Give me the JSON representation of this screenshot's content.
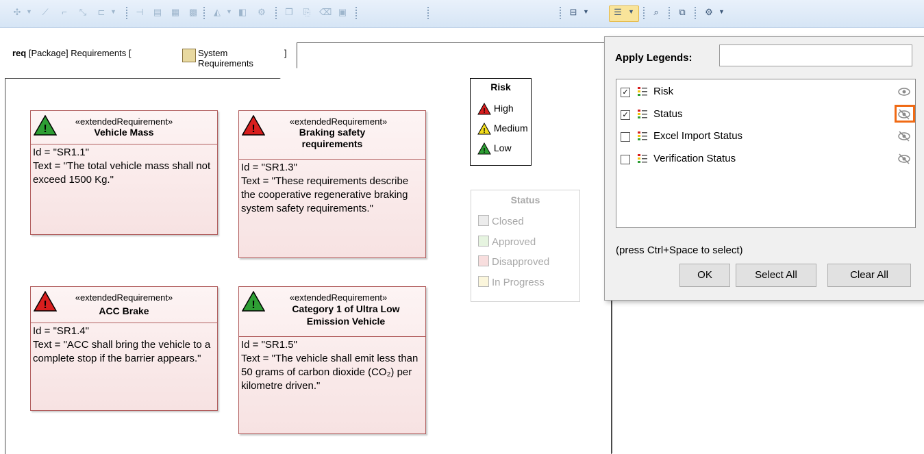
{
  "diagram": {
    "kind": "req",
    "frame_prefix": "[Package] Requirements [",
    "system_name_line1": "System",
    "system_name_line2": "Requirements",
    "frame_suffix": "]"
  },
  "requirements": [
    {
      "stereotype": "«extendedRequirement»",
      "name": "Vehicle Mass",
      "risk": "low",
      "body": "Id = \"SR1.1\"\nText = \"The total vehicle mass shall not exceed 1500 Kg.\""
    },
    {
      "stereotype": "«extendedRequirement»",
      "name": "Braking safety requirements",
      "risk": "high",
      "body": "Id = \"SR1.3\"\nText = \"These requirements describe the cooperative regenerative braking system safety requirements.\""
    },
    {
      "stereotype": "«extendedRequirement»",
      "name": "ACC Brake",
      "risk": "high",
      "body": "Id = \"SR1.4\"\nText = \"ACC shall bring the vehicle to a complete stop if the barrier appears.\""
    },
    {
      "stereotype": "«extendedRequirement»",
      "name": "Category 1 of Ultra Low Emission Vehicle",
      "risk": "low",
      "body": "Id = \"SR1.5\"\nText = \"The vehicle shall emit less than 50 grams of carbon dioxide (CO₂) per kilometre driven.\""
    }
  ],
  "risk_legend": {
    "title": "Risk",
    "items": [
      {
        "label": "High",
        "color": "#d81e1e"
      },
      {
        "label": "Medium",
        "color": "#f2dc1c"
      },
      {
        "label": "Low",
        "color": "#2e9e34"
      }
    ]
  },
  "status_legend": {
    "title": "Status",
    "items": [
      {
        "label": "Closed",
        "color": "#ececec"
      },
      {
        "label": "Approved",
        "color": "#e6f4e0"
      },
      {
        "label": "Disapproved",
        "color": "#f8dede"
      },
      {
        "label": "In Progress",
        "color": "#fbf6dc"
      }
    ]
  },
  "popup": {
    "label": "Apply Legends:",
    "input_value": "",
    "legends": [
      {
        "name": "Risk",
        "checked": true,
        "visible": true
      },
      {
        "name": "Status",
        "checked": true,
        "visible": false
      },
      {
        "name": "Excel Import Status",
        "checked": false,
        "visible": false
      },
      {
        "name": "Verification Status",
        "checked": false,
        "visible": false
      }
    ],
    "hint": "(press Ctrl+Space to select)",
    "ok_label": "OK",
    "select_all_label": "Select All",
    "clear_all_label": "Clear All"
  },
  "toolbar": {
    "icons": [
      "add-element-icon",
      "path-icon",
      "rectilinear-path-icon",
      "oblique-path-icon",
      "bezier-path-icon",
      "align-icon",
      "layout-icon",
      "layout-2-icon",
      "layout-3-icon",
      "fill-color-icon",
      "line-color-icon",
      "font-icon",
      "copy-icon",
      "paste-icon",
      "delete-icon",
      "duplicate-icon",
      "diagram-frame-icon",
      "apply-legends-icon",
      "zoom-icon",
      "display-icon",
      "settings-icon"
    ]
  },
  "colors": {
    "req_border": "#b05c5c",
    "highlight": "#f06a14"
  }
}
